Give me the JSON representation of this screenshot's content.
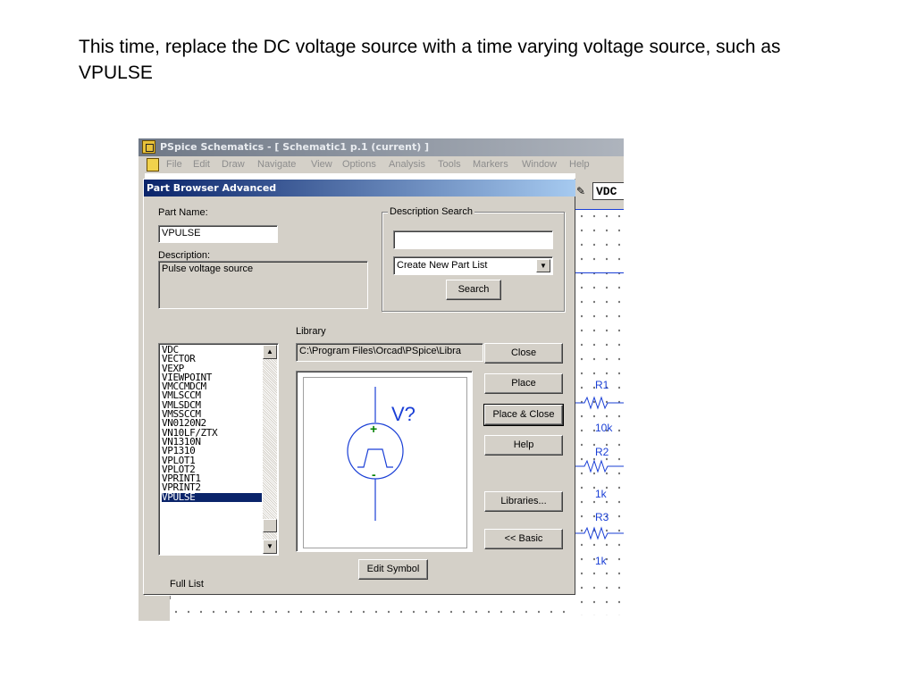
{
  "slide": {
    "text": "This time, replace the DC voltage source with a time varying voltage source, such as VPULSE"
  },
  "window": {
    "title": "PSpice Schematics - [ Schematic1  p.1 (current)  ]",
    "menu": [
      "File",
      "Edit",
      "Draw",
      "Navigate",
      "View",
      "Options",
      "Analysis",
      "Tools",
      "Markers",
      "Window",
      "Help"
    ],
    "toolbar_part": "VDC"
  },
  "schematic": {
    "labels": [
      "R1",
      "10k",
      "R2",
      "1k",
      "R3",
      "1k"
    ],
    "wire_color": "#1a3fd6"
  },
  "dialog": {
    "title": "Part Browser Advanced",
    "part_name_label": "Part Name:",
    "part_name_value": "VPULSE",
    "description_label": "Description:",
    "description_value": "Pulse voltage source",
    "description_search": {
      "title": "Description Search",
      "input_value": "",
      "dropdown_value": "Create New Part List",
      "search_button": "Search"
    },
    "library_label": "Library",
    "library_path": "C:\\Program Files\\Orcad\\PSpice\\Libra",
    "parts": [
      "VDC",
      "VECTOR",
      "VEXP",
      "VIEWPOINT",
      "VMCCMDCM",
      "VMLSCCM",
      "VMLSDCM",
      "VMSSCCM",
      "VN0120N2",
      "VN10LF/ZTX",
      "VN1310N",
      "VP1310",
      "VPLOT1",
      "VPLOT2",
      "VPRINT1",
      "VPRINT2",
      "VPULSE"
    ],
    "selected_part": "VPULSE",
    "symbol_refdes": "V?",
    "buttons": {
      "close": "Close",
      "place": "Place",
      "place_close": "Place & Close",
      "help": "Help",
      "libraries": "Libraries...",
      "basic": "<< Basic",
      "edit_symbol": "Edit Symbol"
    },
    "full_list": "Full List",
    "symbol_color": "#1a3fd6"
  }
}
